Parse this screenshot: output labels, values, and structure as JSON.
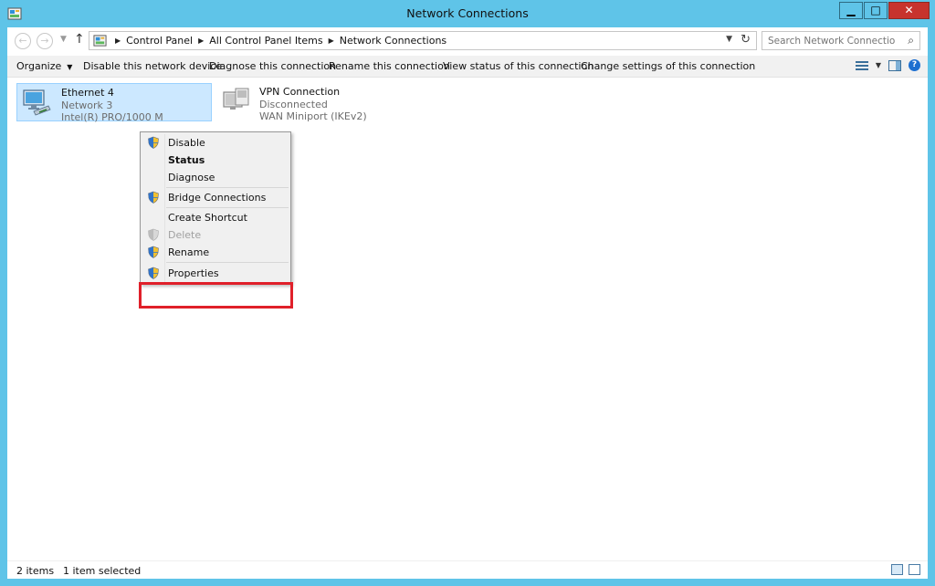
{
  "window": {
    "title": "Network Connections",
    "buttons": {
      "minimize": "▁",
      "maximize": "□",
      "close": "✕"
    }
  },
  "address": {
    "breadcrumbs": [
      "Control Panel",
      "All Control Panel Items",
      "Network Connections"
    ],
    "search_placeholder": "Search Network Connections"
  },
  "toolbar": {
    "organize": "Organize",
    "disable": "Disable this network device",
    "diagnose": "Diagnose this connection",
    "rename": "Rename this connection",
    "view_status": "View status of this connection",
    "change_settings": "Change settings of this connection"
  },
  "connections": [
    {
      "name": "Ethernet 4",
      "status": "Network  3",
      "device": "Intel(R) PRO/1000 M",
      "selected": true
    },
    {
      "name": "VPN Connection",
      "status": "Disconnected",
      "device": "WAN Miniport (IKEv2)",
      "selected": false
    }
  ],
  "context_menu": {
    "items": [
      {
        "label": "Disable",
        "shield": true,
        "bold": false,
        "disabled": false
      },
      {
        "label": "Status",
        "shield": false,
        "bold": true,
        "disabled": false
      },
      {
        "label": "Diagnose",
        "shield": false,
        "bold": false,
        "disabled": false
      },
      {
        "label": "Bridge Connections",
        "shield": true,
        "bold": false,
        "disabled": false
      },
      {
        "label": "Create Shortcut",
        "shield": false,
        "bold": false,
        "disabled": false
      },
      {
        "label": "Delete",
        "shield": true,
        "bold": false,
        "disabled": true
      },
      {
        "label": "Rename",
        "shield": true,
        "bold": false,
        "disabled": false
      },
      {
        "label": "Properties",
        "shield": true,
        "bold": false,
        "disabled": false
      }
    ],
    "highlighted_item": "Properties"
  },
  "statusbar": {
    "items_count": "2 items",
    "selected_count": "1 item selected"
  },
  "colors": {
    "frame": "#5fc4e8",
    "selection": "#cce8ff",
    "highlight_box": "#e0202a",
    "close_button": "#c7332d"
  }
}
